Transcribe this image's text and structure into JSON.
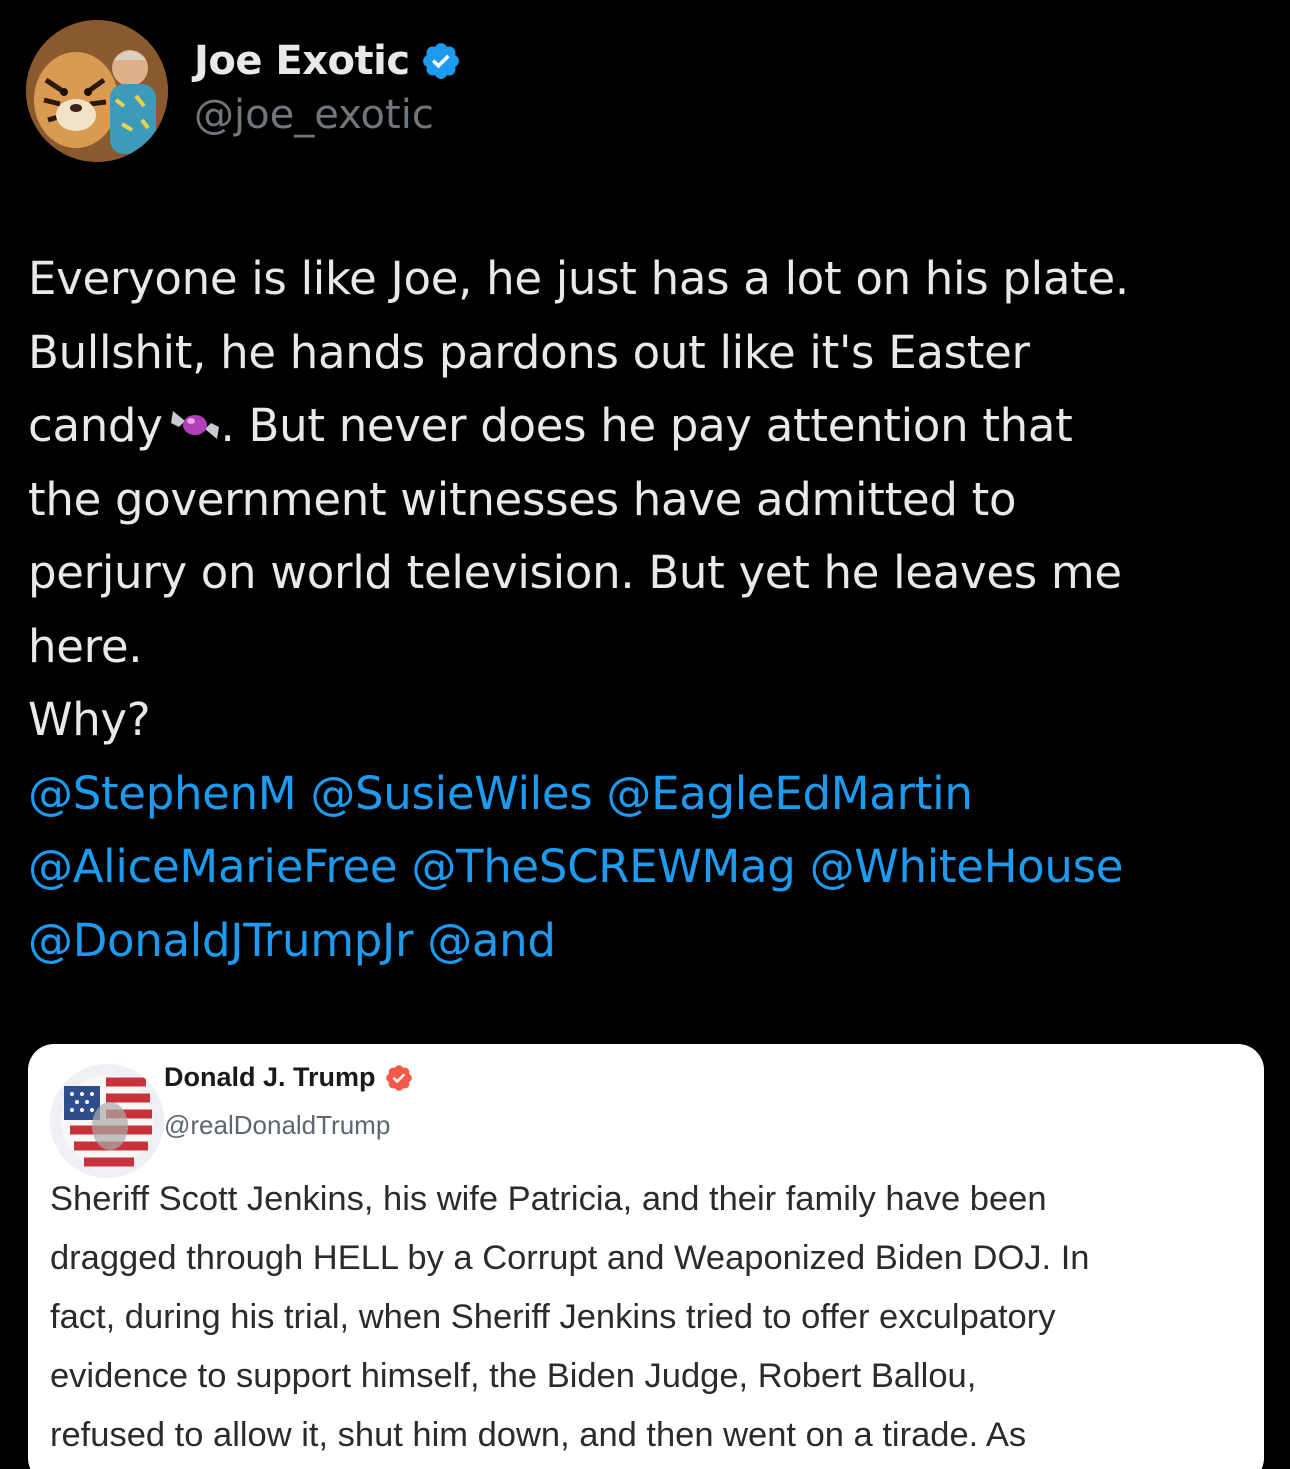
{
  "author": {
    "display_name": "Joe Exotic",
    "handle": "@joe_exotic",
    "avatar_icon": "tiger-portrait-avatar",
    "verified_icon": "verified-badge-icon",
    "verified_color": "#1d9bf0"
  },
  "tweet": {
    "lines": [
      "Everyone is like Joe, he just has a lot on his plate.",
      "Bullshit, he hands pardons out like it's Easter",
      "candy",
      ".  But never does he pay attention that",
      "the government witnesses have admitted to",
      "perjury on world television.  But yet he leaves me",
      "here.",
      "Why?"
    ],
    "emoji": "candy-emoji",
    "mentions": [
      [
        "@StephenM",
        "@SusieWiles",
        "@EagleEdMartin"
      ],
      [
        "@AliceMarieFree",
        "@TheSCREWMag",
        "@WhiteHouse"
      ],
      [
        "@DonaldJTrumpJr",
        "@and"
      ]
    ],
    "mention_color": "#1d9bf0",
    "text_color": "#e7e9ea"
  },
  "quoted_post": {
    "display_name": "Donald J. Trump",
    "handle": "@realDonaldTrump",
    "avatar_icon": "flag-portrait-avatar",
    "verified_color": "#f25a4a",
    "body_lines": [
      "Sheriff Scott Jenkins, his wife Patricia, and their family have been",
      "dragged through HELL by a Corrupt and Weaponized Biden DOJ. In",
      "fact, during his trial, when Sheriff Jenkins tried to offer exculpatory",
      "evidence to support himself, the Biden Judge, Robert Ballou,",
      "refused to allow it, shut him down, and then went on a tirade. As"
    ]
  }
}
